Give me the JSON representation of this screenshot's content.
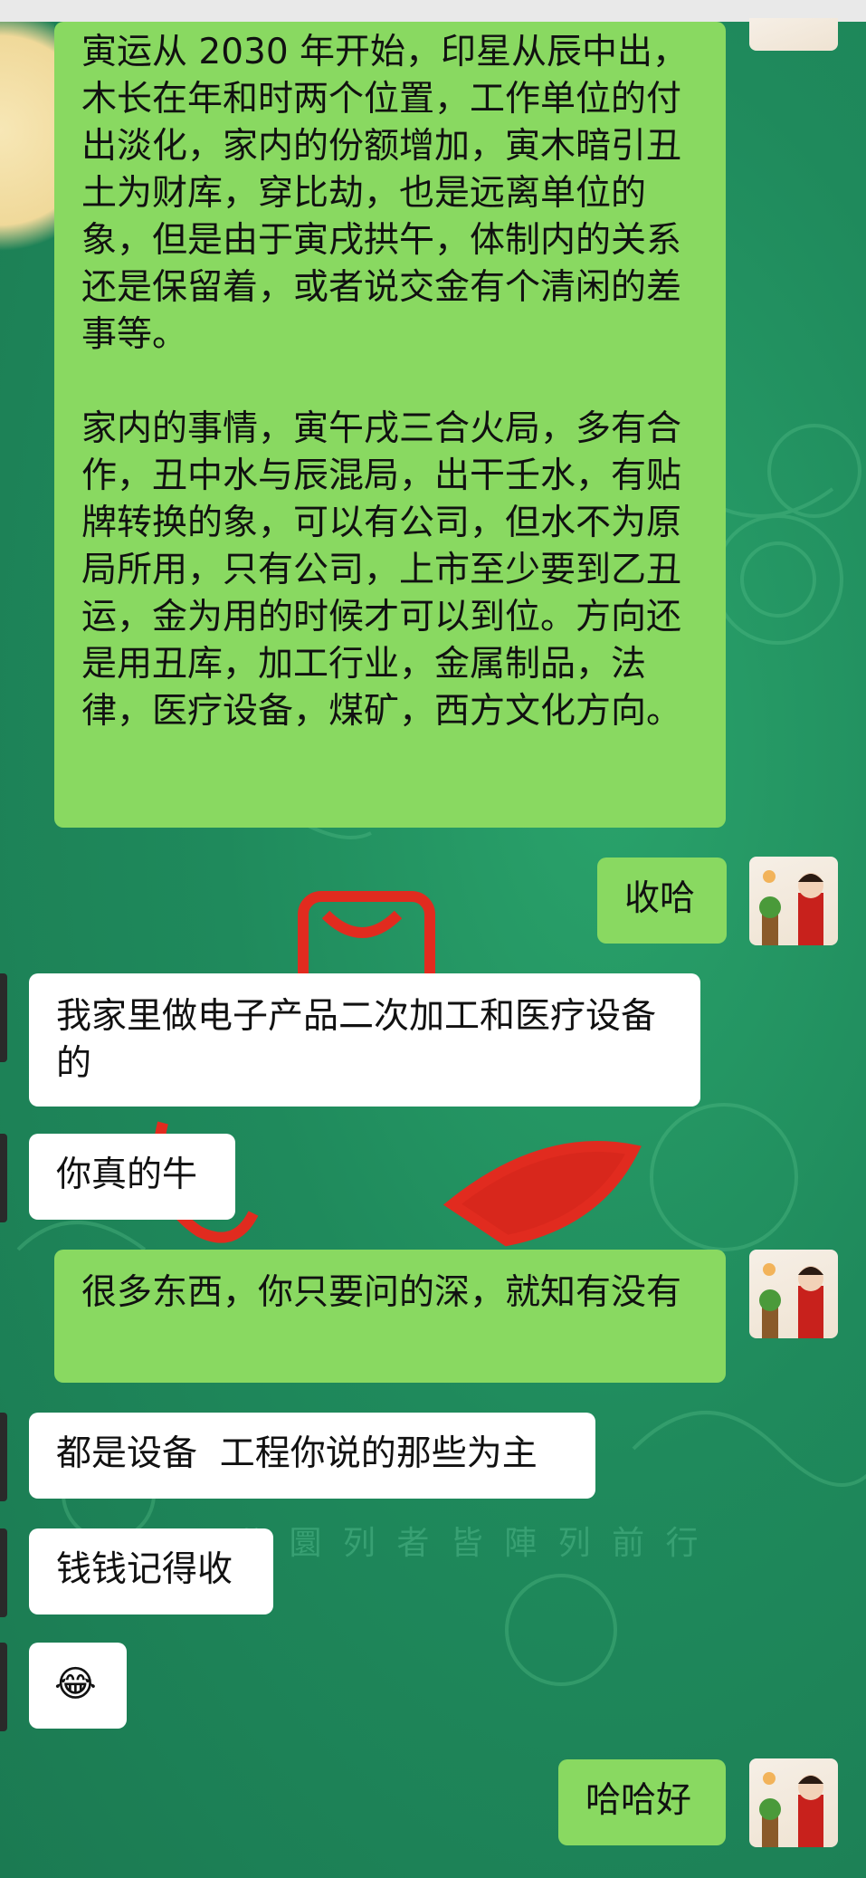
{
  "messages": [
    {
      "side": "right",
      "paragraphs": [
        "寅运从 2030 年开始，印星从辰中出，木长在年和时两个位置，工作单位的付出淡化，家内的份额增加，寅木暗引丑土为财库，穿比劫，也是远离单位的象，但是由于寅戌拱午，体制内的关系还是保留着，或者说交金有个清闲的差事等。",
        "家内的事情，寅午戌三合火局，多有合作，丑中水与辰混局，出干壬水，有贴牌转换的象，可以有公司，但水不为原局所用，只有公司，上市至少要到乙丑运，金为用的时候才可以到位。方向还是用丑库，加工行业，金属制品，法律，医疗设备，煤矿，西方文化方向。"
      ]
    },
    {
      "side": "right",
      "text": "收哈"
    },
    {
      "side": "left",
      "text": "我家里做电子产品二次加工和医疗设备的"
    },
    {
      "side": "left",
      "text": "你真的牛"
    },
    {
      "side": "right",
      "text": "很多东西，你只要问的深，就知有没有"
    },
    {
      "side": "left",
      "text": "都是设备  工程你说的那些为主"
    },
    {
      "side": "left",
      "text": "钱钱记得收"
    },
    {
      "side": "left",
      "emoji": "😂"
    },
    {
      "side": "right",
      "text": "哈哈好"
    }
  ],
  "background_caption": "公 圜 列 者 皆 陣 列 前 行",
  "colors": {
    "background": "#1f8a5c",
    "sent_bubble": "#89d961",
    "received_bubble": "#ffffff"
  },
  "icons": [
    "user-avatar-icon",
    "contact-avatar-icon"
  ]
}
